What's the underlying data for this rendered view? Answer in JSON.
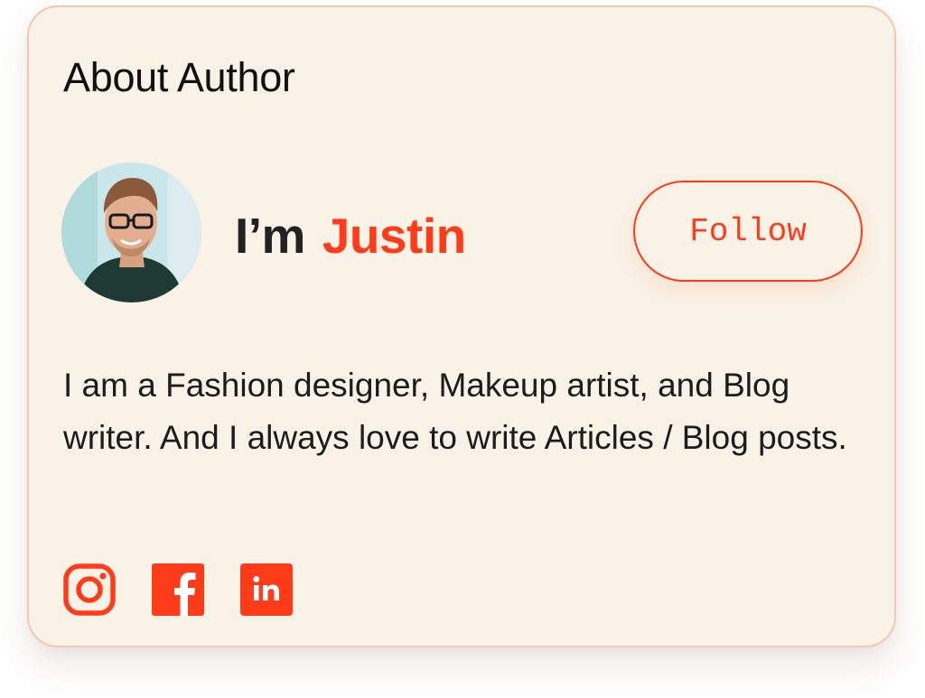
{
  "card": {
    "title": "About Author"
  },
  "author": {
    "greeting_prefix": "I’m",
    "name": "Justin",
    "avatar_alt": "Photo of Justin",
    "follow_label": "Follow",
    "bio": "I am a Fashion designer, Makeup artist, and Blog writer. And I always love to write Articles / Blog posts."
  },
  "socials": [
    {
      "icon": "instagram-icon"
    },
    {
      "icon": "facebook-icon"
    },
    {
      "icon": "linkedin-icon"
    }
  ],
  "colors": {
    "accent": "#ff3b1a",
    "card_background": "#f9f2e6",
    "card_border": "#f5c6b2",
    "text": "#1c1c1c"
  }
}
